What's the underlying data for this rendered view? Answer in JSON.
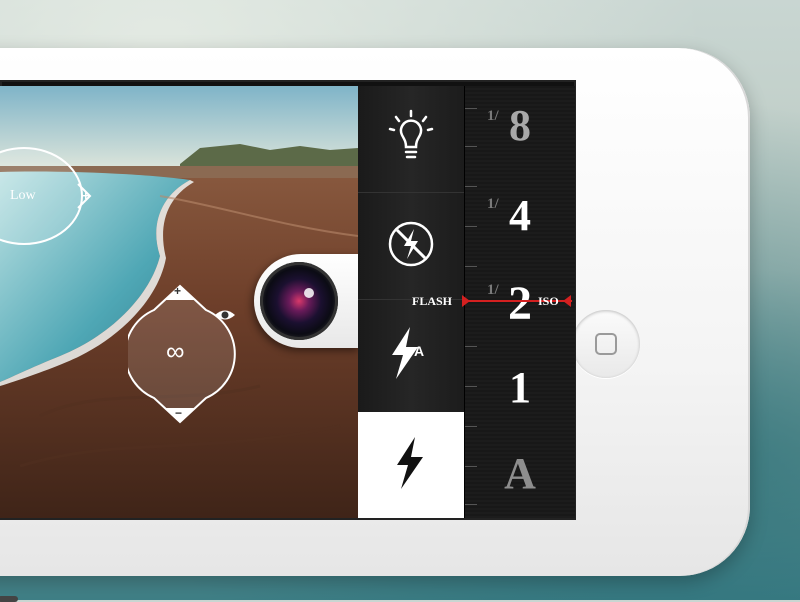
{
  "exposure_dial": {
    "label": "Low",
    "plus": "+"
  },
  "focus_dial": {
    "symbol": "∞",
    "plus": "+",
    "minus": "−"
  },
  "mode_panel": {
    "items": [
      {
        "name": "light",
        "icon": "lightbulb-icon"
      },
      {
        "name": "flash-off",
        "icon": "flash-off-icon"
      },
      {
        "name": "flash-auto",
        "icon": "flash-auto-icon",
        "badge": "A"
      },
      {
        "name": "flash-on",
        "icon": "flash-on-icon",
        "selected": true
      }
    ]
  },
  "iso_ruler": {
    "values": [
      {
        "fraction": "1/",
        "label": "8"
      },
      {
        "fraction": "1/",
        "label": "4"
      },
      {
        "fraction": "1/",
        "label": "2"
      },
      {
        "fraction": "",
        "label": "1"
      },
      {
        "fraction": "",
        "label": "A"
      }
    ],
    "left_tag": "FLASH",
    "right_tag": "ISO",
    "indicator_color": "#d42020"
  }
}
